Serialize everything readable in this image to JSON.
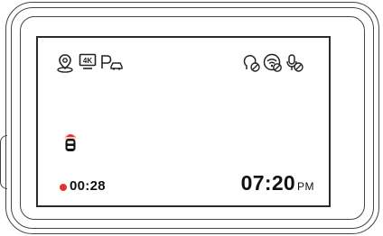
{
  "device": {
    "status_icons_left": [
      "gps-icon",
      "4k-resolution-icon",
      "parking-mode-icon"
    ],
    "status_icons_right": [
      "voice-control-off-icon",
      "wifi-off-icon",
      "microphone-off-icon"
    ],
    "resolution_badge": "4K",
    "recording": {
      "elapsed": "00:28",
      "indicator_color": "#e3342f"
    },
    "clock": {
      "time": "07:20",
      "period": "PM"
    },
    "car_indicator": "rear-camera-car-icon"
  }
}
